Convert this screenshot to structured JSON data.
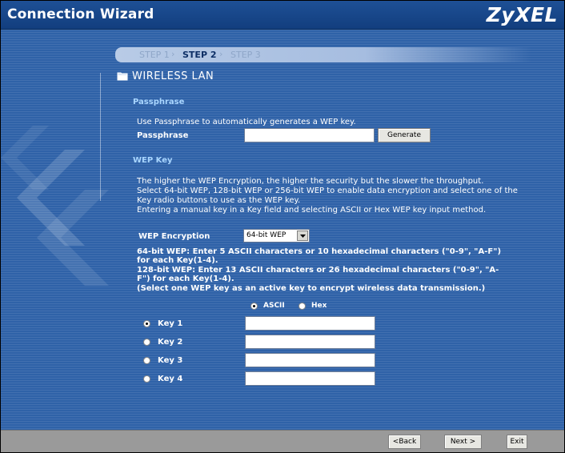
{
  "window": {
    "title": "Connection Wizard",
    "logo": "ZyXEL"
  },
  "steps": [
    "STEP 1",
    "STEP 2",
    "STEP 3"
  ],
  "step_active_index": 1,
  "section": {
    "title": "WIRELESS LAN",
    "icon": "folder-icon"
  },
  "passphrase": {
    "heading": "Passphrase",
    "description": "Use Passphrase to automatically generates a WEP key.",
    "label": "Passphrase",
    "value": "",
    "generate_label": "Generate"
  },
  "wep": {
    "heading": "WEP Key",
    "description_lines": [
      "The higher the WEP Encryption, the higher the security but the slower the throughput.",
      "Select 64-bit WEP, 128-bit WEP or 256-bit WEP to enable data encryption and select one of the",
      "Key radio buttons to use as the WEP key.",
      "Entering a manual key in a Key field and selecting ASCII or Hex WEP key input method."
    ],
    "encryption_label": "WEP Encryption",
    "encryption_value": "64-bit WEP",
    "notes": [
      "64-bit WEP: Enter 5 ASCII characters or 10 hexadecimal characters (\"0-9\", \"A-F\")",
      "for each Key(1-4).",
      "128-bit WEP: Enter 13 ASCII characters or 26 hexadecimal characters (\"0-9\", \"A-",
      "F\") for each Key(1-4).",
      "(Select one WEP key as an active key to encrypt wireless data transmission.)"
    ],
    "input_method": {
      "ascii_label": "ASCII",
      "hex_label": "Hex",
      "selected": "ASCII"
    },
    "keys": [
      {
        "label": "Key 1",
        "value": "",
        "selected": true
      },
      {
        "label": "Key 2",
        "value": "",
        "selected": false
      },
      {
        "label": "Key 3",
        "value": "",
        "selected": false
      },
      {
        "label": "Key 4",
        "value": "",
        "selected": false
      }
    ]
  },
  "footer": {
    "back_label": "<Back",
    "next_label": "Next >",
    "exit_label": "Exit"
  },
  "colors": {
    "background": "#2f62a8",
    "titlebar": "#123e7e",
    "heading": "#a9d6ff",
    "bottom_bar": "#9a9a9a"
  }
}
